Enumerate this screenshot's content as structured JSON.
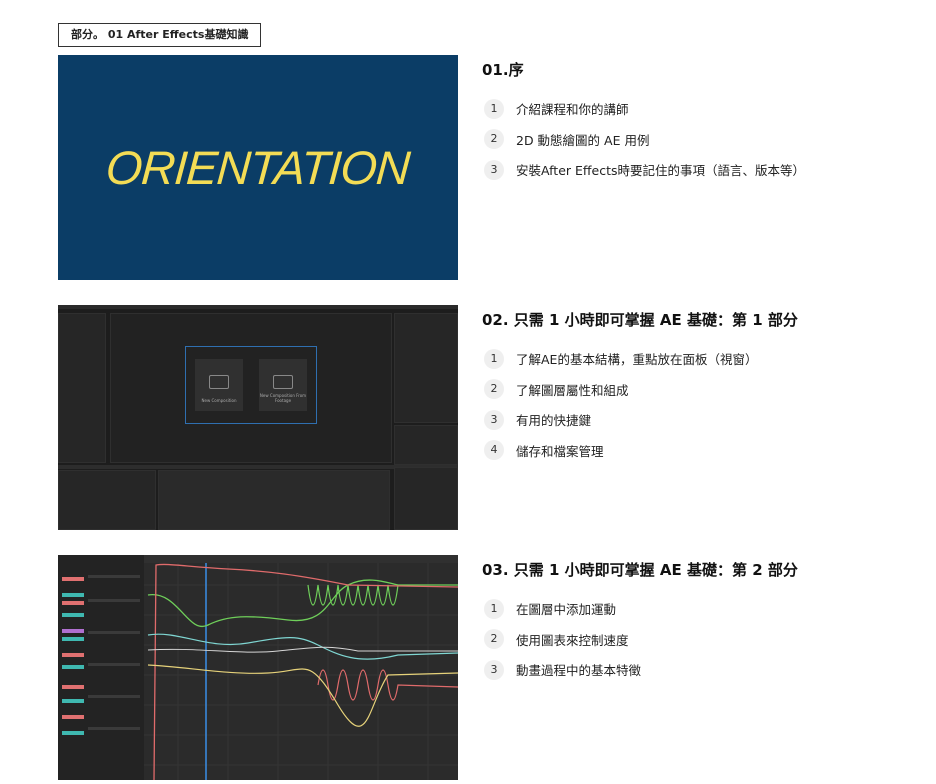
{
  "section": {
    "label": "部分。 01 After Effects基礎知識"
  },
  "lessons": [
    {
      "title": "01.序",
      "thumbnail_text": "ORIENTATION",
      "items": [
        {
          "num": "1",
          "text": "介紹課程和你的講師"
        },
        {
          "num": "2",
          "text": "2D 動態繪圖的 AE 用例"
        },
        {
          "num": "3",
          "text": "安裝After Effects時要記住的事項（語言、版本等）"
        }
      ]
    },
    {
      "title": "02. 只需 1 小時即可掌握 AE 基礎：第 1 部分",
      "thumbnail": {
        "card1": "New Composition",
        "card2": "New Composition From Footage"
      },
      "items": [
        {
          "num": "1",
          "text": "了解AE的基本結構，重點放在面板（視窗）"
        },
        {
          "num": "2",
          "text": "了解圖層屬性和組成"
        },
        {
          "num": "3",
          "text": "有用的快捷鍵"
        },
        {
          "num": "4",
          "text": "儲存和檔案管理"
        }
      ]
    },
    {
      "title": "03. 只需 1 小時即可掌握 AE 基礎：第 2 部分",
      "items": [
        {
          "num": "1",
          "text": "在圖層中添加運動"
        },
        {
          "num": "2",
          "text": "使用圖表來控制速度"
        },
        {
          "num": "3",
          "text": "動畫過程中的基本特徵"
        }
      ]
    }
  ],
  "colors": {
    "orientation_bg": "#0b3d66",
    "orientation_text": "#f3dc55",
    "ae_dark": "#1d1d1d",
    "graph_bg": "#2b2b2b",
    "curve_green": "#6fcf5a",
    "curve_red": "#e06b6b",
    "curve_cyan": "#7fd6d2",
    "curve_yellow": "#e6d27a",
    "playhead_blue": "#3a8ee6"
  }
}
